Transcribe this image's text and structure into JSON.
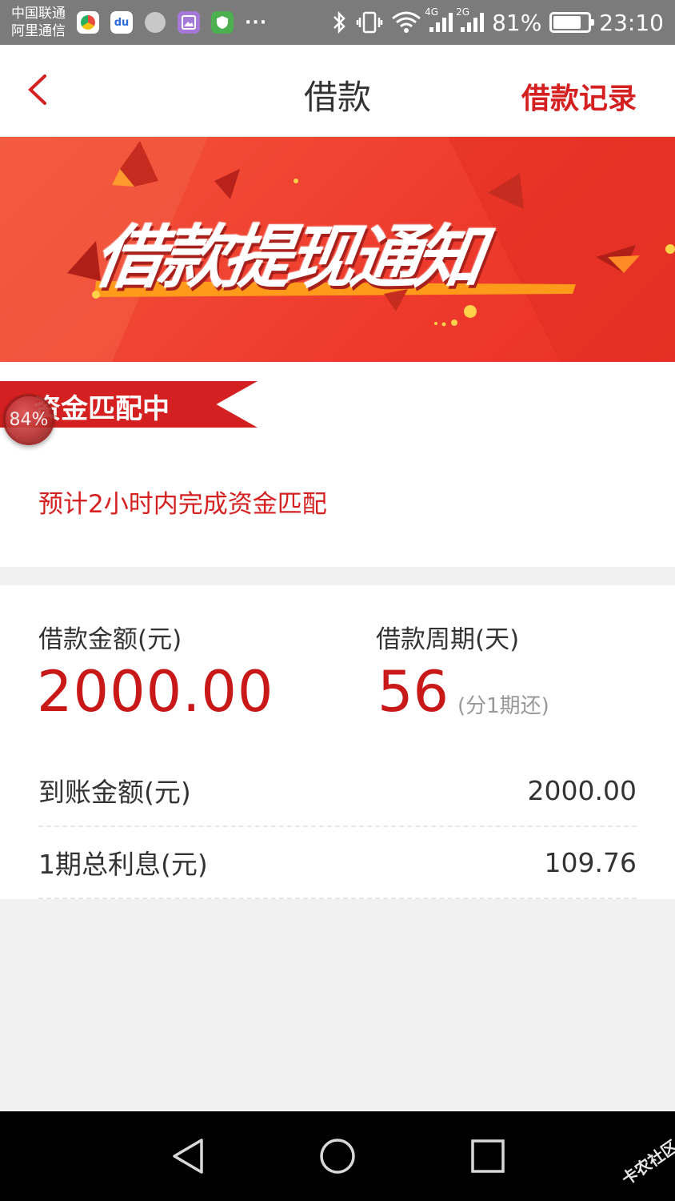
{
  "status_bar": {
    "carrier_1": "中国联通",
    "carrier_2": "阿里通信",
    "more_dots": "···",
    "network_1": "4G",
    "network_2": "2G",
    "battery_percent": "81%",
    "battery_level": 0.81,
    "time": "23:10",
    "notification_icons": [
      "browser-icon",
      "baidu-icon",
      "circle-app-icon",
      "gallery-icon",
      "shield-icon"
    ],
    "baidu_glyph": "du"
  },
  "header": {
    "title": "借款",
    "record_link": "借款记录",
    "back_icon": "chevron-left-icon"
  },
  "banner": {
    "headline": "借款提现通知",
    "slide_count": 5,
    "active_slide": 5
  },
  "status_card": {
    "ribbon_label": "资金匹配中",
    "progress": "84%",
    "note": "预计2小时内完成资金匹配"
  },
  "details": {
    "amount_label": "借款金额(元)",
    "amount_value": "2000.00",
    "period_label": "借款周期(天)",
    "period_value": "56",
    "period_note": "(分1期还)",
    "received_label": "到账金额(元)",
    "received_value": "2000.00",
    "interest_label": "1期总利息(元)",
    "interest_value": "109.76"
  },
  "nav_bar": {
    "watermark": "卡农社区"
  },
  "colors": {
    "accent": "#d42020",
    "banner": "#ee3b2d",
    "status_bar": "#7b7b7b"
  }
}
